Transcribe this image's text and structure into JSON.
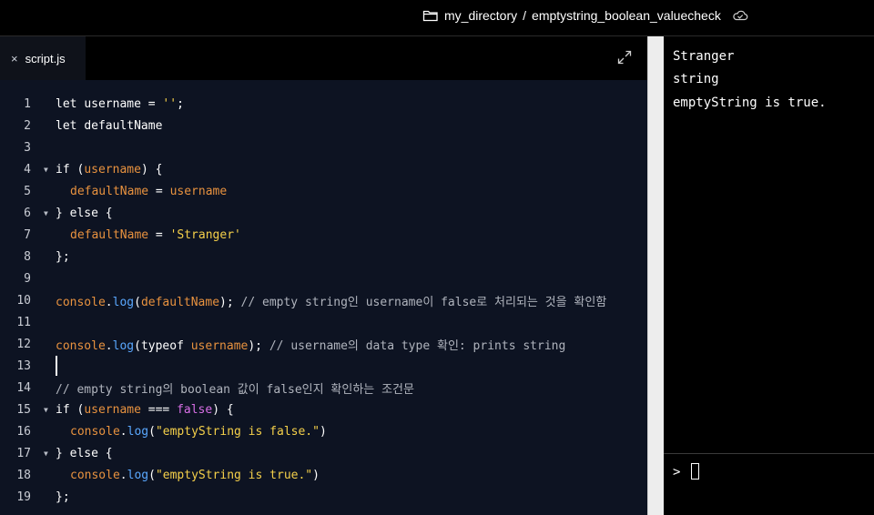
{
  "breadcrumb": {
    "folder": "my_directory",
    "separator": "/",
    "file": "emptystring_boolean_valuecheck"
  },
  "editor": {
    "tab_label": "script.js",
    "close_glyph": "×"
  },
  "code_lines": [
    {
      "n": "1"
    },
    {
      "n": "2"
    },
    {
      "n": "3"
    },
    {
      "n": "4"
    },
    {
      "n": "5"
    },
    {
      "n": "6"
    },
    {
      "n": "7"
    },
    {
      "n": "8"
    },
    {
      "n": "9"
    },
    {
      "n": "10"
    },
    {
      "n": "11"
    },
    {
      "n": "12"
    },
    {
      "n": "13"
    },
    {
      "n": "14"
    },
    {
      "n": "15"
    },
    {
      "n": "16"
    },
    {
      "n": "17"
    },
    {
      "n": "18"
    },
    {
      "n": "19"
    }
  ],
  "code": {
    "l1": {
      "kw": "let ",
      "id": "username",
      "op": " = ",
      "str": "''",
      "end": ";"
    },
    "l2": {
      "kw": "let ",
      "id": "defaultName"
    },
    "l4": {
      "kw": "if ",
      "p1": "(",
      "id": "username",
      "p2": ") {"
    },
    "l5": {
      "id": "defaultName",
      "op": " = ",
      "id2": "username"
    },
    "l6": {
      "text": "} else {"
    },
    "l7": {
      "id": "defaultName",
      "op": " = ",
      "str": "'Stranger'"
    },
    "l8": {
      "text": "};"
    },
    "l10": {
      "obj": "console",
      "dot": ".",
      "fn": "log",
      "p1": "(",
      "arg": "defaultName",
      "p2": ");",
      "cmt": " // empty string인 username이 false로 처리되는 것을 확인함"
    },
    "l12": {
      "obj": "console",
      "dot": ".",
      "fn": "log",
      "p1": "(",
      "kw": "typeof ",
      "arg": "username",
      "p2": ");",
      "cmt": " // username의 data type 확인: prints string"
    },
    "l14": {
      "cmt": "// empty string의 boolean 값이 false인지 확인하는 조건문"
    },
    "l15": {
      "kw": "if ",
      "p1": "(",
      "id": "username",
      "op": " === ",
      "bool": "false",
      "p2": ") {"
    },
    "l16": {
      "obj": "console",
      "dot": ".",
      "fn": "log",
      "p1": "(",
      "str": "\"emptyString is false.\"",
      "p2": ")"
    },
    "l17": {
      "text": "} else {"
    },
    "l18": {
      "obj": "console",
      "dot": ".",
      "fn": "log",
      "p1": "(",
      "str": "\"emptyString is true.\"",
      "p2": ")"
    },
    "l19": {
      "text": "};"
    }
  },
  "output": {
    "lines": [
      "Stranger",
      "string",
      "emptyString is true."
    ],
    "prompt": ">"
  },
  "icons": {
    "folder": "folder-icon",
    "cloud": "cloud-saved-icon",
    "expand": "expand-icon",
    "close": "close-icon"
  },
  "colors": {
    "editor_bg": "#0d1322",
    "variable": "#e8923f",
    "function": "#5aa8ff",
    "string": "#f5d04a",
    "boolean": "#d86fe6",
    "comment": "#b0b4bd"
  }
}
